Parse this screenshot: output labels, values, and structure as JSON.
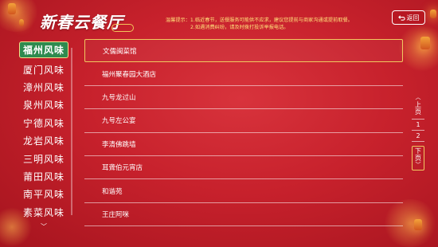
{
  "header": {
    "title": "新春云餐厅",
    "notice_lines": [
      "温馨提示：1.临近春节，送餐服务可能供不应求，建议您提前与商家沟通或提前取餐。",
      "2.如遇消费纠纷，请及时拨打投诉举报电话。"
    ],
    "back_label": "返回",
    "back_icon": "return-arrow-icon"
  },
  "sidebar": {
    "items": [
      {
        "label": "福州风味",
        "active": true
      },
      {
        "label": "厦门风味"
      },
      {
        "label": "漳州风味"
      },
      {
        "label": "泉州风味"
      },
      {
        "label": "宁德风味"
      },
      {
        "label": "龙岩风味"
      },
      {
        "label": "三明风味"
      },
      {
        "label": "莆田风味"
      },
      {
        "label": "南平风味"
      },
      {
        "label": "素菜风味"
      }
    ],
    "more_glyph": "﹀"
  },
  "list": {
    "items": [
      "文儒闽菜馆",
      "福州聚春园大酒店",
      "九号龙过山",
      "九号左公宴",
      "李清佛跳墙",
      "耳聋伯元宵店",
      "和谐苑",
      "王庄阿咪"
    ],
    "selected_index": 0
  },
  "pager": {
    "prev_label": [
      "上",
      "页"
    ],
    "pages": [
      "1",
      "2"
    ],
    "next_label": [
      "下",
      "页"
    ]
  },
  "colors": {
    "background": "#c7212c",
    "accent_gold": "#f0c960",
    "active_green": "#2e8a4f",
    "notice_yellow": "#ffe07a"
  }
}
